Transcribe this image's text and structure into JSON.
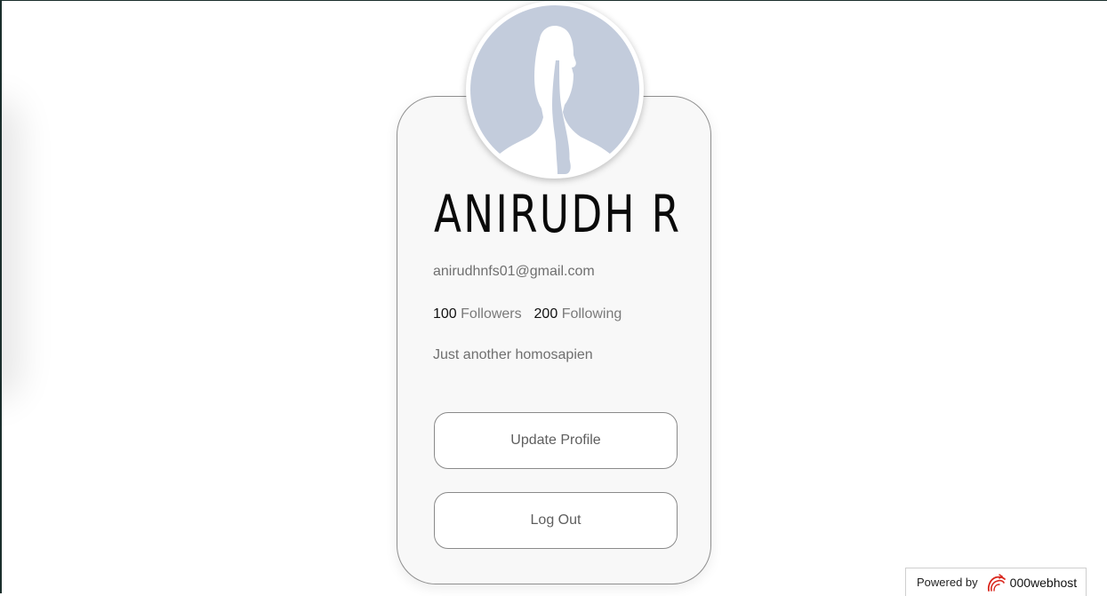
{
  "profile": {
    "name": "ANIRUDH R",
    "email": "anirudhnfs01@gmail.com",
    "followers_count": "100",
    "followers_label": "Followers",
    "following_count": "200",
    "following_label": "Following",
    "bio": "Just another homosapien"
  },
  "actions": {
    "update_label": "Update Profile",
    "logout_label": "Log Out"
  },
  "footer": {
    "powered_label": "Powered by",
    "brand": "000webhost"
  },
  "icons": {
    "avatar": "default-avatar-silhouette",
    "brand_logo": "000webhost-logo-icon"
  },
  "colors": {
    "card_bg": "#f8f8f8",
    "card_border": "#8f8f8f",
    "avatar_bg": "#c3ccdc",
    "brand_red": "#d9261c"
  }
}
